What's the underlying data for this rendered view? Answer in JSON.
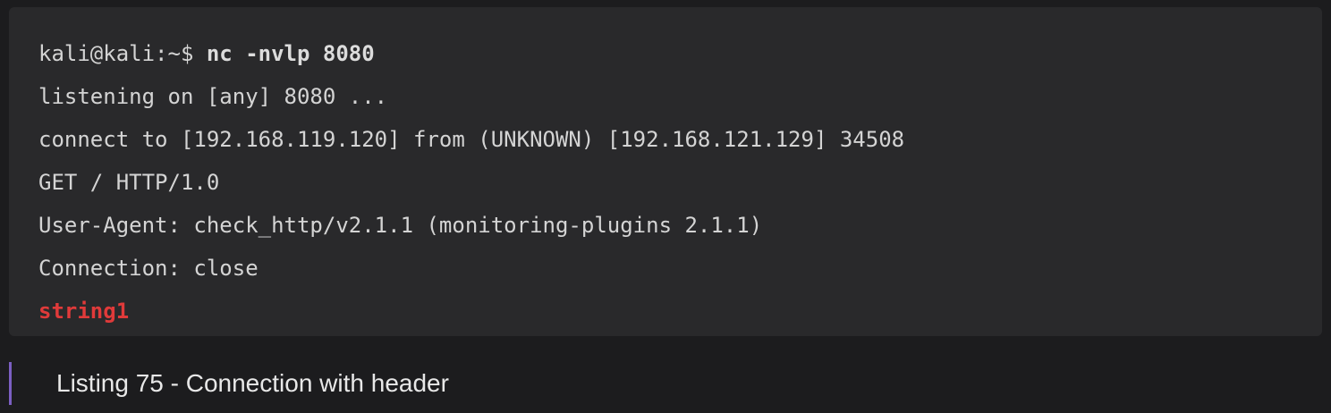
{
  "terminal": {
    "prompt": "kali@kali:~$ ",
    "command": "nc -nvlp 8080",
    "output": [
      "listening on [any] 8080 ...",
      "connect to [192.168.119.120] from (UNKNOWN) [192.168.121.129] 34508",
      "GET / HTTP/1.0",
      "User-Agent: check_http/v2.1.1 (monitoring-plugins 2.1.1)",
      "Connection: close"
    ],
    "highlight": "string1"
  },
  "caption": {
    "text": "Listing 75 - Connection with header"
  },
  "colors": {
    "background": "#1c1c1e",
    "code_background": "#29292b",
    "text": "#d4d4d4",
    "highlight": "#e03a3a",
    "caption_bar": "#7b5fc2"
  }
}
